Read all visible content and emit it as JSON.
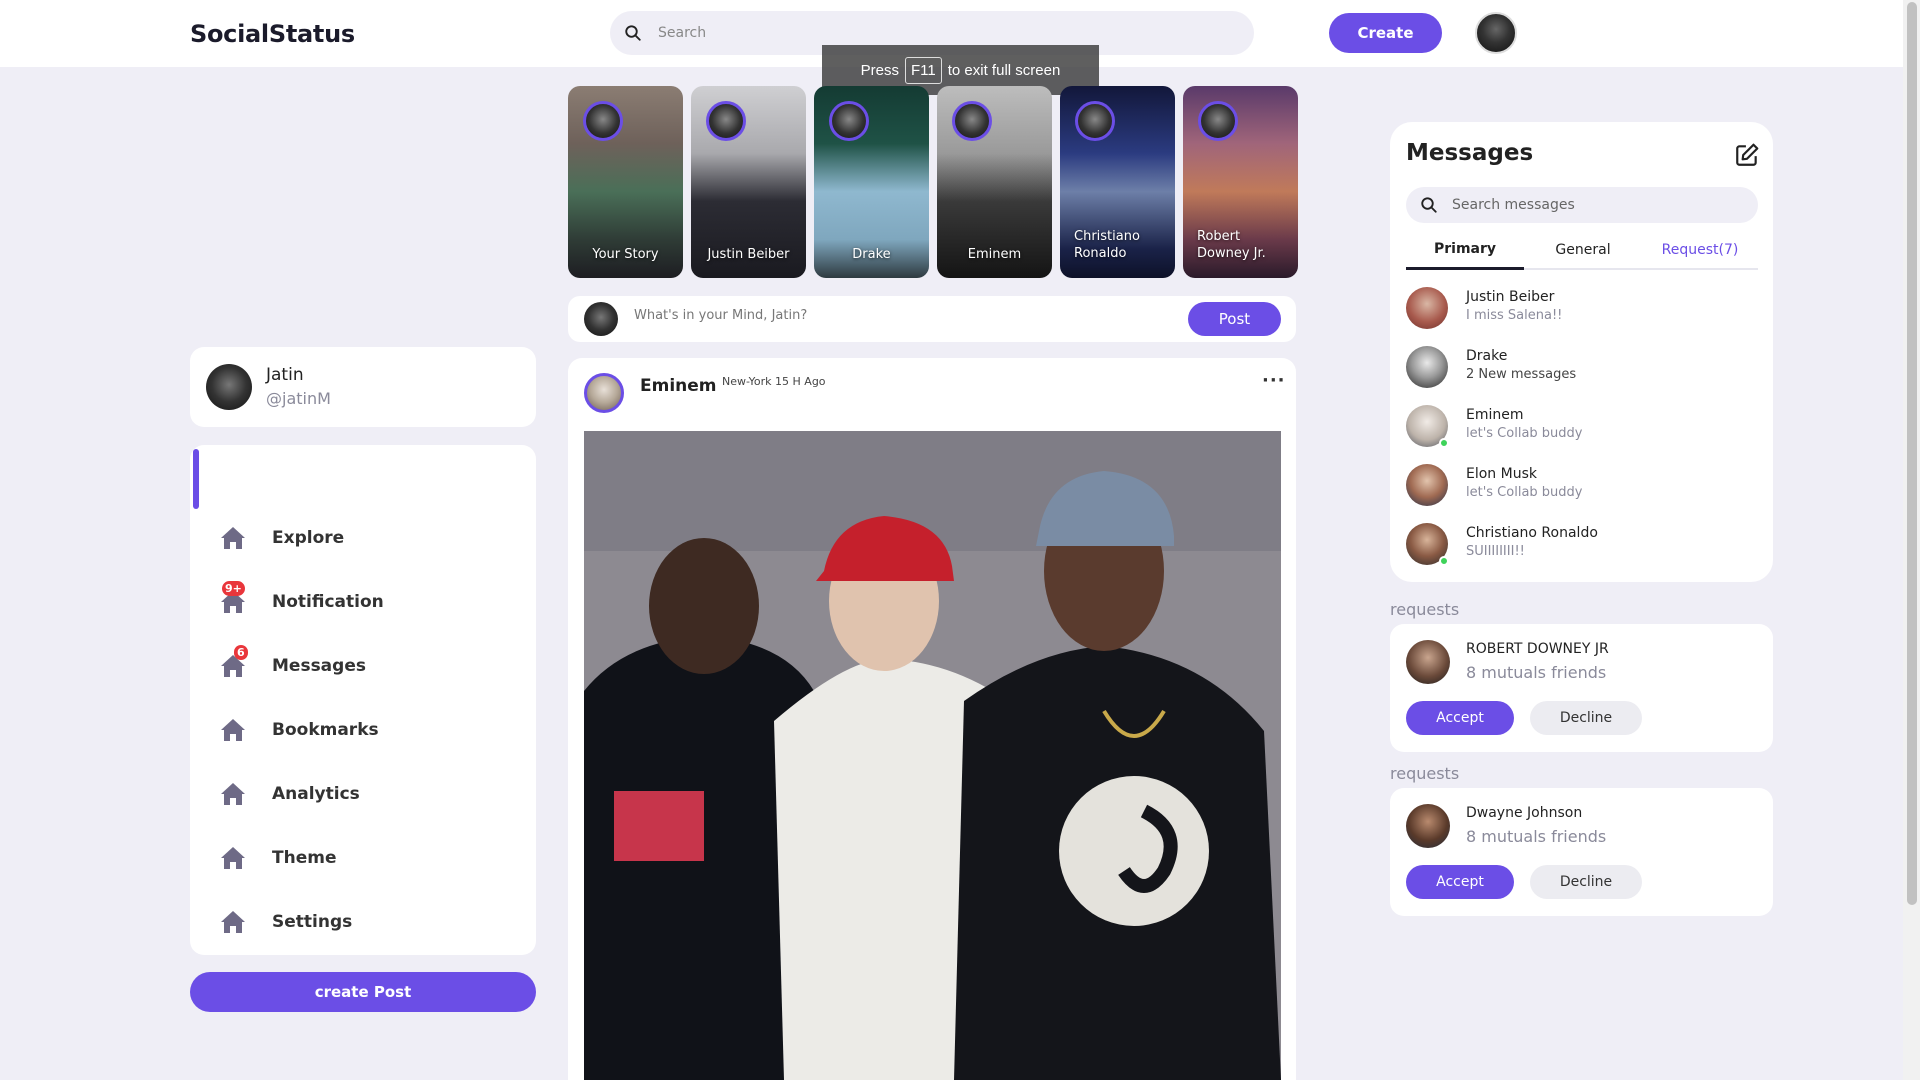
{
  "app": {
    "logo": "SocialStatus"
  },
  "header": {
    "search_placeholder": "Search",
    "create_label": "Create"
  },
  "fullscreen_toast": {
    "before": "Press",
    "key": "F11",
    "after": "to exit full screen"
  },
  "profile": {
    "name": "Jatin",
    "handle": "@jatinM"
  },
  "sidebar": {
    "items": [
      {
        "label": "Explore",
        "icon": "home-icon",
        "badge": ""
      },
      {
        "label": "Notification",
        "icon": "home-icon",
        "badge": "9+"
      },
      {
        "label": "Messages",
        "icon": "home-icon",
        "badge": "6"
      },
      {
        "label": "Bookmarks",
        "icon": "home-icon",
        "badge": ""
      },
      {
        "label": "Analytics",
        "icon": "home-icon",
        "badge": ""
      },
      {
        "label": "Theme",
        "icon": "home-icon",
        "badge": ""
      },
      {
        "label": "Settings",
        "icon": "home-icon",
        "badge": ""
      }
    ],
    "create_post_label": "create Post",
    "accent": "#6b4ee6",
    "badge_color": "#e9363b"
  },
  "stories": [
    {
      "name": "Your Story"
    },
    {
      "name": "Justin Beiber"
    },
    {
      "name": "Drake"
    },
    {
      "name": "Eminem"
    },
    {
      "name": "Christiano Ronaldo"
    },
    {
      "name": "Robert Downey Jr."
    }
  ],
  "compose": {
    "placeholder": "What's in your Mind, Jatin?",
    "post_label": "Post"
  },
  "feed": {
    "post": {
      "author": "Eminem",
      "meta": "New-York 15 H Ago",
      "more_icon": "more-horizontal-icon"
    }
  },
  "messages": {
    "title": "Messages",
    "search_placeholder": "Search messages",
    "tabs": [
      {
        "label": "Primary"
      },
      {
        "label": "General"
      },
      {
        "label": "Request(7)"
      }
    ],
    "conversations": [
      {
        "name": "Justin Beiber",
        "preview": "I miss Salena!!"
      },
      {
        "name": "Drake",
        "preview": "2 New messages"
      },
      {
        "name": "Eminem",
        "preview": "let's Collab buddy"
      },
      {
        "name": "Elon Musk",
        "preview": "let's Collab buddy"
      },
      {
        "name": "Christiano Ronaldo",
        "preview": "SUIIIIIIII!!"
      }
    ]
  },
  "requests": [
    {
      "heading": "requests",
      "name": "ROBERT DOWNEY JR",
      "mutuals": "8 mutuals friends",
      "accept": "Accept",
      "decline": "Decline"
    },
    {
      "heading": "requests",
      "name": "Dwayne Johnson",
      "mutuals": "8 mutuals friends",
      "accept": "Accept",
      "decline": "Decline"
    }
  ]
}
